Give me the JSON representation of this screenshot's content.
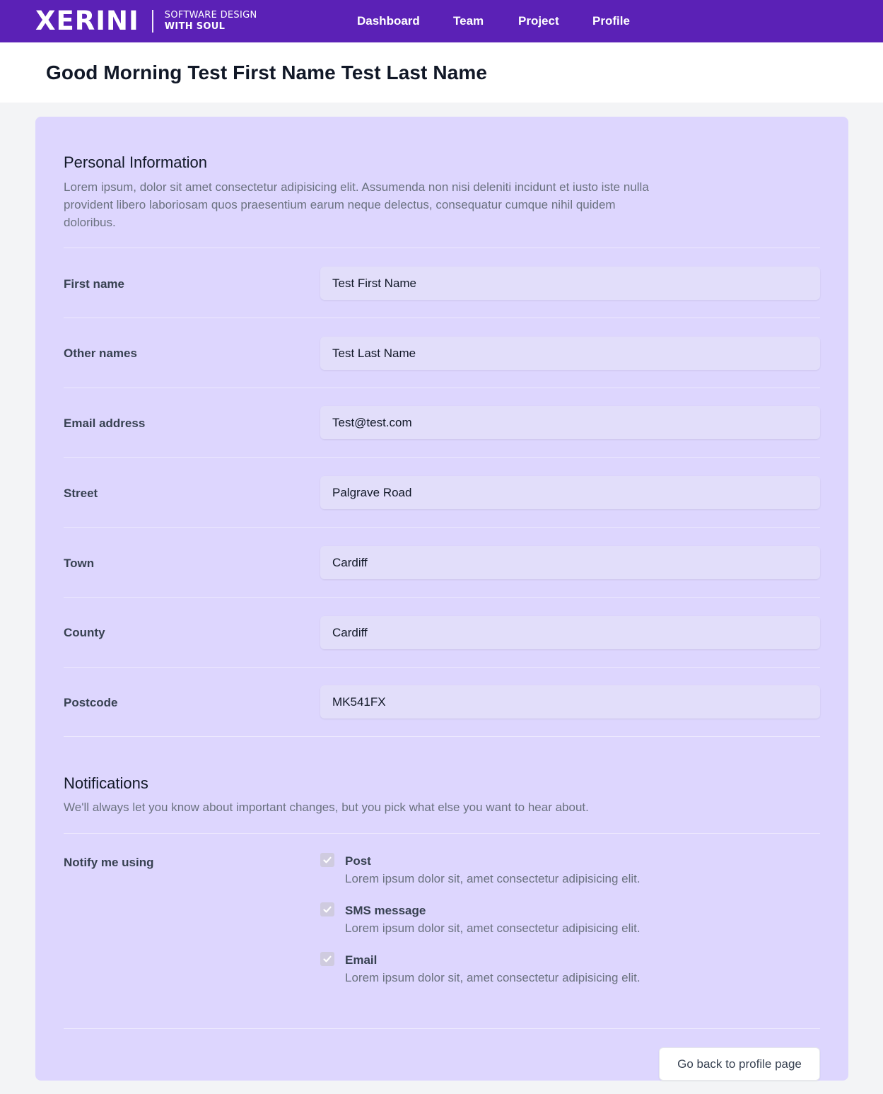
{
  "brand": {
    "name": "XERINI",
    "tagline_line1": "SOFTWARE DESIGN",
    "tagline_line2": "WITH SOUL",
    "color": "#5b21b6"
  },
  "nav": {
    "items": [
      {
        "label": "Dashboard"
      },
      {
        "label": "Team"
      },
      {
        "label": "Project"
      },
      {
        "label": "Profile"
      }
    ]
  },
  "header": {
    "title": "Good Morning Test First Name Test Last Name"
  },
  "personal": {
    "title": "Personal Information",
    "description": "Lorem ipsum, dolor sit amet consectetur adipisicing elit. Assumenda non nisi deleniti incidunt et iusto iste nulla provident libero laboriosam quos praesentium earum neque delectus, consequatur cumque nihil quidem doloribus.",
    "fields": [
      {
        "label": "First name",
        "value": "Test First Name"
      },
      {
        "label": "Other names",
        "value": "Test Last Name"
      },
      {
        "label": "Email address",
        "value": "Test@test.com"
      },
      {
        "label": "Street",
        "value": "Palgrave Road"
      },
      {
        "label": "Town",
        "value": "Cardiff"
      },
      {
        "label": "County",
        "value": "Cardiff"
      },
      {
        "label": "Postcode",
        "value": "MK541FX"
      }
    ]
  },
  "notifications": {
    "title": "Notifications",
    "description": "We'll always let you know about important changes, but you pick what else you want to hear about.",
    "label": "Notify me using",
    "options": [
      {
        "title": "Post",
        "description": "Lorem ipsum dolor sit, amet consectetur adipisicing elit.",
        "checked": true
      },
      {
        "title": "SMS message",
        "description": "Lorem ipsum dolor sit, amet consectetur adipisicing elit.",
        "checked": true
      },
      {
        "title": "Email",
        "description": "Lorem ipsum dolor sit, amet consectetur adipisicing elit.",
        "checked": true
      }
    ]
  },
  "actions": {
    "back_label": "Go back to profile page"
  }
}
